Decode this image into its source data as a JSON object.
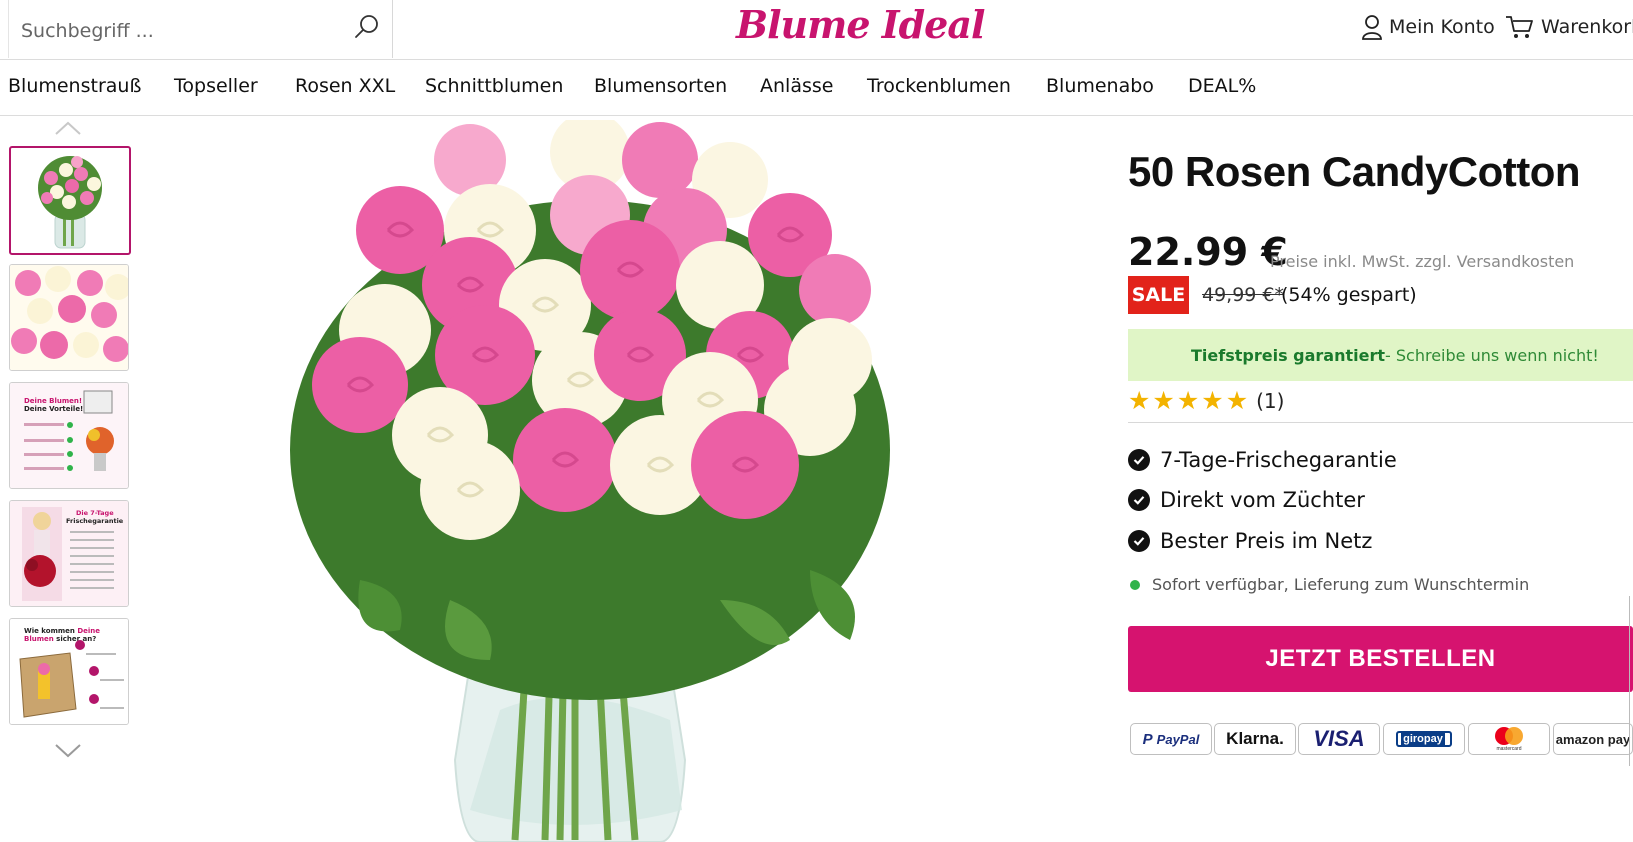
{
  "header": {
    "search_placeholder": "Suchbegriff ...",
    "logo_text": "Blume Ideal",
    "account_label": "Mein Konto",
    "cart_label": "Warenkorb"
  },
  "nav": {
    "items": [
      "Blumenstrauß",
      "Topseller",
      "Rosen XXL",
      "Schnittblumen",
      "Blumensorten",
      "Anlässe",
      "Trockenblumen",
      "Blumenabo",
      "DEAL%"
    ]
  },
  "gallery": {
    "thumb_count": 5,
    "active_index": 0,
    "thumb3_text": [
      "Deine Blumen!",
      "Deine Vorteile!"
    ],
    "thumb4_text": [
      "Die 7-Tage",
      "Frischegarantie"
    ],
    "thumb5_text": [
      "Wie kommen ",
      "Deine",
      "Blumen",
      " sicher an?"
    ]
  },
  "product": {
    "title": "50 Rosen CandyCotton",
    "price": "22.99 €",
    "price_note": "Preise inkl. MwSt. zzgl. Versandkosten",
    "sale_badge": "SALE",
    "old_price": "49,99 €*",
    "saved": "(54% gespart)",
    "guarantee_bold": "Tiefstpreis garantiert",
    "guarantee_rest": " - Schreibe uns wenn nicht!",
    "rating": {
      "stars": 5,
      "count": "(1)"
    },
    "features": [
      "7-Tage-Frischegarantie",
      "Direkt vom Züchter",
      "Bester Preis im Netz"
    ],
    "availability": "Sofort verfügbar, Lieferung zum Wunschtermin",
    "order_button": "JETZT BESTELLEN"
  },
  "payments": [
    "PayPal",
    "Klarna.",
    "VISA",
    "giropay",
    "mastercard",
    "amazon pay"
  ],
  "colors": {
    "brand": "#d6136f",
    "sale": "#e2231a",
    "guarantee_bg": "#e0f5c6",
    "star": "#f3b300",
    "available": "#2fb34a"
  }
}
